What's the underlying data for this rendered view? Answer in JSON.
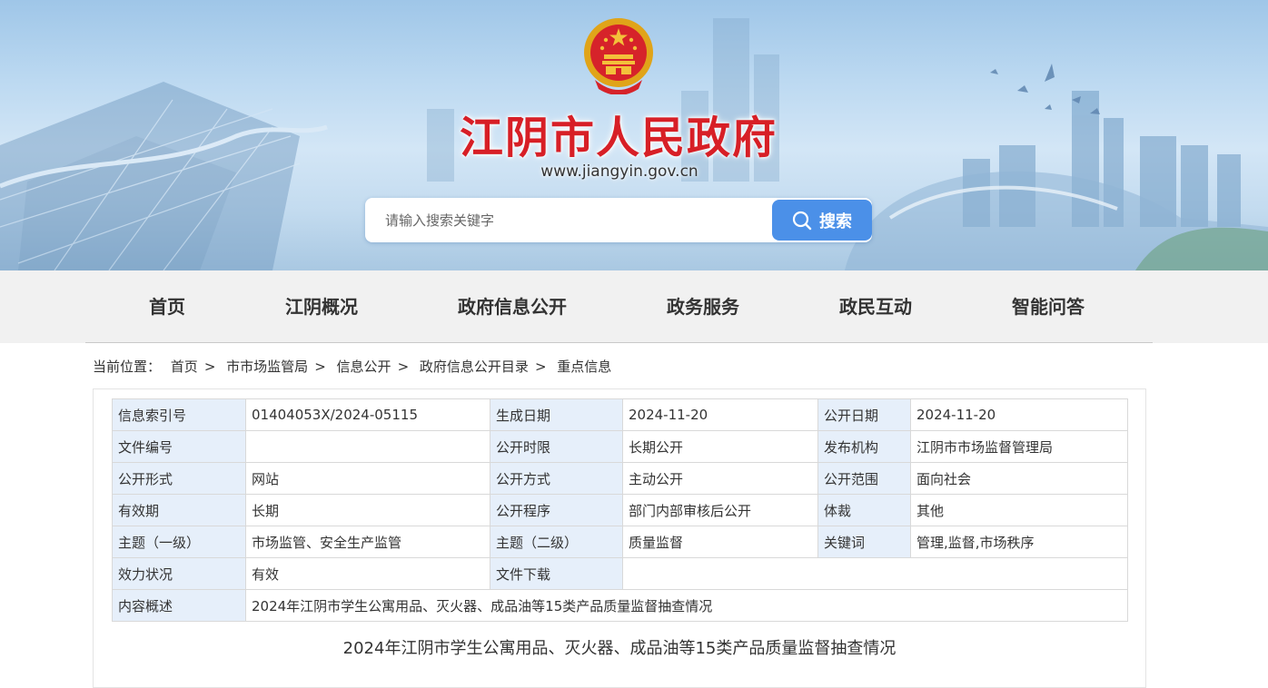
{
  "header": {
    "site_name": "江阴市人民政府",
    "domain": "www.jiangyin.gov.cn",
    "emblem": "national-emblem",
    "accent_color": "#d71f26"
  },
  "search": {
    "placeholder": "请输入搜索关键字",
    "button_label": "搜索",
    "button_color": "#4b90e8",
    "icon": "search-icon"
  },
  "nav": {
    "items": [
      "首页",
      "江阴概况",
      "政府信息公开",
      "政务服务",
      "政民互动",
      "智能问答"
    ]
  },
  "breadcrumb": {
    "prefix": "当前位置：",
    "items": [
      "首页",
      "市市场监管局",
      "信息公开",
      "政府信息公开目录",
      "重点信息"
    ],
    "separator": ">"
  },
  "meta": {
    "index_no_label": "信息索引号",
    "index_no": "01404053X/2024-05115",
    "gen_date_label": "生成日期",
    "gen_date": "2024-11-20",
    "pub_date_label": "公开日期",
    "pub_date": "2024-11-20",
    "file_no_label": "文件编号",
    "file_no": "",
    "limit_label": "公开时限",
    "limit": "长期公开",
    "org_label": "发布机构",
    "org": "江阴市市场监督管理局",
    "form_label": "公开形式",
    "form": "网站",
    "method_label": "公开方式",
    "method": "主动公开",
    "scope_label": "公开范围",
    "scope": "面向社会",
    "validity_label": "有效期",
    "validity": "长期",
    "procedure_label": "公开程序",
    "procedure": "部门内部审核后公开",
    "genre_label": "体裁",
    "genre": "其他",
    "topic1_label": "主题（一级）",
    "topic1": "市场监管、安全生产监管",
    "topic2_label": "主题（二级）",
    "topic2": "质量监督",
    "keywords_label": "关键词",
    "keywords": "管理,监督,市场秩序",
    "status_label": "效力状况",
    "status": "有效",
    "download_label": "文件下载",
    "download": "",
    "summary_label": "内容概述",
    "summary": "2024年江阴市学生公寓用品、灭火器、成品油等15类产品质量监督抽查情况"
  },
  "document": {
    "title": "2024年江阴市学生公寓用品、灭火器、成品油等15类产品质量监督抽查情况"
  }
}
